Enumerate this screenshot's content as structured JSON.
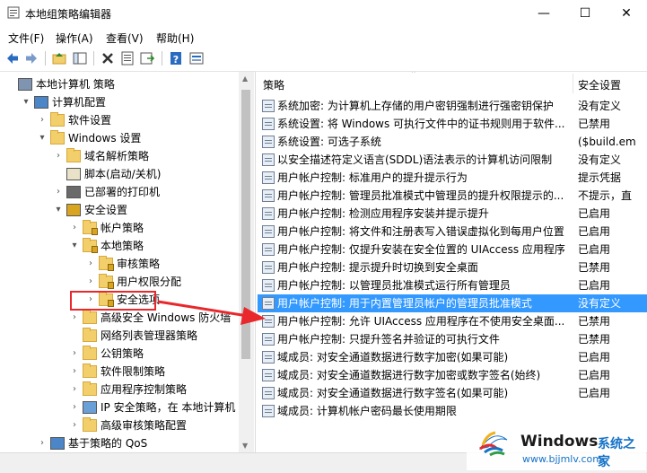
{
  "window": {
    "title": "本地组策略编辑器",
    "min": "—",
    "max": "☐",
    "close": "✕"
  },
  "menu": [
    "文件(F)",
    "操作(A)",
    "查看(V)",
    "帮助(H)"
  ],
  "toolbar_icons": [
    "back-icon",
    "forward-icon",
    "up-folder-icon",
    "show-tree-icon",
    "delete-icon",
    "properties-icon",
    "export-icon",
    "help-icon",
    "view-icon"
  ],
  "tree": [
    {
      "label": "本地计算机 策略",
      "toggle": "",
      "icon": "computer"
    },
    {
      "label": "计算机配置",
      "toggle": "▾",
      "icon": "monitor"
    },
    {
      "label": "软件设置",
      "toggle": "›",
      "icon": "folder"
    },
    {
      "label": "Windows 设置",
      "toggle": "▾",
      "icon": "folder"
    },
    {
      "label": "域名解析策略",
      "toggle": "›",
      "icon": "folder"
    },
    {
      "label": "脚本(启动/关机)",
      "toggle": "",
      "icon": "script"
    },
    {
      "label": "已部署的打印机",
      "toggle": "›",
      "icon": "printer"
    },
    {
      "label": "安全设置",
      "toggle": "▾",
      "icon": "security"
    },
    {
      "label": "帐户策略",
      "toggle": "›",
      "icon": "folder-lock"
    },
    {
      "label": "本地策略",
      "toggle": "▾",
      "icon": "folder-lock"
    },
    {
      "label": "审核策略",
      "toggle": "›",
      "icon": "folder-lock"
    },
    {
      "label": "用户权限分配",
      "toggle": "›",
      "icon": "folder-lock"
    },
    {
      "label": "安全选项",
      "toggle": "›",
      "icon": "folder-lock"
    },
    {
      "label": "高级安全 Windows 防火墙",
      "toggle": "›",
      "icon": "folder"
    },
    {
      "label": "网络列表管理器策略",
      "toggle": "",
      "icon": "folder"
    },
    {
      "label": "公钥策略",
      "toggle": "›",
      "icon": "folder"
    },
    {
      "label": "软件限制策略",
      "toggle": "›",
      "icon": "folder"
    },
    {
      "label": "应用程序控制策略",
      "toggle": "›",
      "icon": "folder"
    },
    {
      "label": "IP 安全策略，在 本地计算机",
      "toggle": "›",
      "icon": "ipsec"
    },
    {
      "label": "高级审核策略配置",
      "toggle": "›",
      "icon": "folder"
    },
    {
      "label": "基于策略的 QoS",
      "toggle": "›",
      "icon": "chart"
    }
  ],
  "list_header": {
    "policy": "策略",
    "setting": "安全设置"
  },
  "rows": [
    {
      "name": "系统加密: 为计算机上存储的用户密钥强制进行强密钥保护",
      "value": "没有定义"
    },
    {
      "name": "系统设置: 将 Windows 可执行文件中的证书规则用于软件...",
      "value": "已禁用"
    },
    {
      "name": "系统设置: 可选子系统",
      "value": "($build.em"
    },
    {
      "name": "以安全描述符定义语言(SDDL)语法表示的计算机访问限制",
      "value": "没有定义"
    },
    {
      "name": "用户帐户控制: 标准用户的提升提示行为",
      "value": "提示凭据"
    },
    {
      "name": "用户帐户控制: 管理员批准模式中管理员的提升权限提示的...",
      "value": "不提示，直"
    },
    {
      "name": "用户帐户控制: 检测应用程序安装并提示提升",
      "value": "已启用"
    },
    {
      "name": "用户帐户控制: 将文件和注册表写入错误虚拟化到每用户位置",
      "value": "已启用"
    },
    {
      "name": "用户帐户控制: 仅提升安装在安全位置的 UIAccess 应用程序",
      "value": "已启用"
    },
    {
      "name": "用户帐户控制: 提示提升时切换到安全桌面",
      "value": "已禁用"
    },
    {
      "name": "用户帐户控制: 以管理员批准模式运行所有管理员",
      "value": "已启用"
    },
    {
      "name": "用户帐户控制: 用于内置管理员帐户的管理员批准模式",
      "value": "没有定义"
    },
    {
      "name": "用户帐户控制: 允许 UIAccess 应用程序在不使用安全桌面...",
      "value": "已禁用"
    },
    {
      "name": "用户帐户控制: 只提升签名并验证的可执行文件",
      "value": "已禁用"
    },
    {
      "name": "域成员: 对安全通道数据进行数字加密(如果可能)",
      "value": "已启用"
    },
    {
      "name": "域成员: 对安全通道数据进行数字加密或数字签名(始终)",
      "value": "已启用"
    },
    {
      "name": "域成员: 对安全通道数据进行数字签名(如果可能)",
      "value": "已启用"
    },
    {
      "name": "域成员: 计算机帐户密码最长使用期限",
      "value": ""
    }
  ],
  "selected_row_index": 11,
  "highlighted_tree_index": 12,
  "watermark": {
    "brand": "Windows",
    "brand2": "系统之家",
    "url": "www.bjjmlv.com"
  },
  "colors": {
    "selection": "#3399ff",
    "annotation": "#e8282c",
    "folder": "#f2cf6b"
  }
}
